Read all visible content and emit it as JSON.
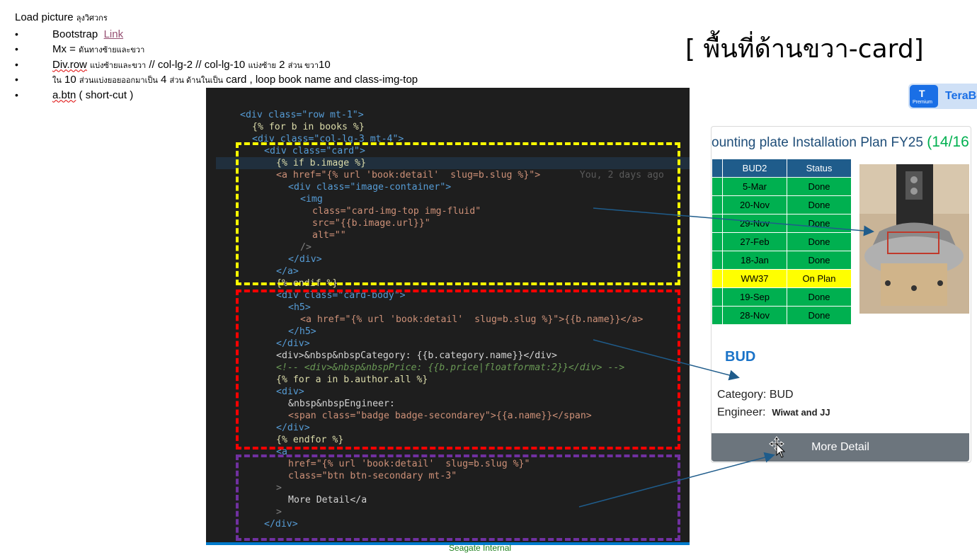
{
  "notes": {
    "title": "Load picture",
    "title_small": "ลุงวิศวกร",
    "items": [
      {
        "main": "Bootstrap",
        "link": "Link"
      },
      {
        "main": "Mx  =",
        "small": "ดันทางซ้ายและขวา"
      },
      {
        "main": "Div.row",
        "small": "แบ่งซ้ายและขวา",
        "rest": "  // col-lg-2   // col-lg-10 ",
        "small2": "แบ่งซ้าย",
        "rest2": " 2 ",
        "small3": "ส่วน ขวา",
        "rest3": "10"
      },
      {
        "pre": "ใน",
        "rest": " 10 ",
        "small": "ส่วนแบ่งยอยออกมาเป็น",
        "rest2": "  4 ",
        "small2": "ส่วน ด้านในเป็น",
        "rest3": " card , loop book name and class-img-top"
      },
      {
        "main": "a.btn",
        "rest": " ( short-cut )"
      }
    ]
  },
  "heading_right": "[ พื้นที่ด้านขวา-card]",
  "terabox": {
    "name": "TeraBo",
    "badge": "Premium"
  },
  "code": {
    "lines": [
      "<div class=\"row mt-1\">",
      "{% for b in books %}",
      "<div class=\"col-lg-3 mt-4\">",
      "<div class=\"card\">",
      "{% if b.image %}",
      "<a href=\"{% url 'book:detail'  slug=b.slug %}\">",
      "<div class=\"image-container\">",
      "<img",
      "class=\"card-img-top img-fluid\"",
      "src=\"{{b.image.url}}\"",
      "alt=\"\"",
      "/>",
      "</div>",
      "</a>",
      "{% endif %}",
      "<div class=\"card-body\">",
      "<h5>",
      "<a href=\"{% url 'book:detail'  slug=b.slug %}\">{{b.name}}</a>",
      "</h5>",
      "</div>",
      "<div>&nbsp&nbspCategory: {{b.category.name}}</div>",
      "<!-- <div>&nbsp&nbspPrice: {{b.price|floatformat:2}}</div> -->",
      "{% for a in b.author.all %}",
      "<div>",
      "&nbsp&nbspEngineer:",
      "<span class=\"badge badge-secondarey\">{{a.name}}</span>",
      "</div>",
      "{% endfor %}",
      "<a",
      "href=\"{% url 'book:detail'  slug=b.slug %}\"",
      "class=\"btn btn-secondary mt-3\"",
      ">",
      "More Detail</a",
      ">",
      "</div>"
    ],
    "blame": "You, 2 days ago"
  },
  "footer": "Seagate Internal",
  "card": {
    "title": "ounting plate Installation Plan FY25",
    "title_frac": "(14/16 :",
    "table_headers": [
      "",
      "BUD2",
      "Status"
    ],
    "rows": [
      {
        "date": "5-Mar",
        "status": "Done"
      },
      {
        "date": "20-Nov",
        "status": "Done"
      },
      {
        "date": "29-Nov",
        "status": "Done"
      },
      {
        "date": "27-Feb",
        "status": "Done"
      },
      {
        "date": "18-Jan",
        "status": "Done"
      },
      {
        "date": "WW37",
        "status": "On Plan"
      },
      {
        "date": "19-Sep",
        "status": "Done"
      },
      {
        "date": "28-Nov",
        "status": "Done"
      }
    ],
    "name": "BUD",
    "category_label": "Category: BUD",
    "engineer_label": "Engineer:",
    "engineer_value": "Wiwat and JJ",
    "button": "More Detail"
  },
  "colors": {
    "yellow_box": "#ffff00",
    "red_box": "#ff0000",
    "purple_box": "#7030a0",
    "arrow": "#1f5c8b",
    "button": "#6c757d"
  }
}
